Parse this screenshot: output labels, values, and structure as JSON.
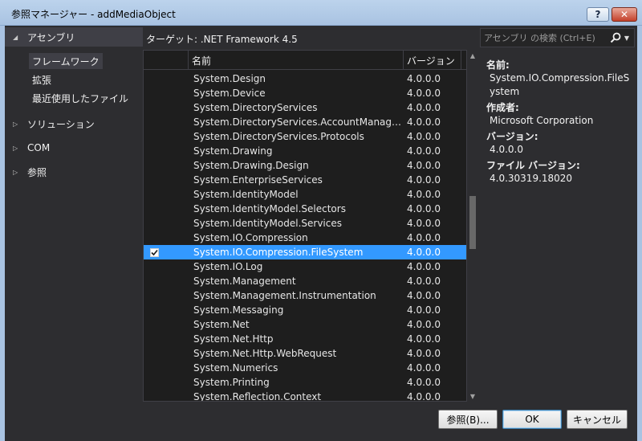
{
  "window": {
    "title": "参照マネージャー - addMediaObject",
    "help_label": "?",
    "close_label": "✕"
  },
  "nav": {
    "assemblies": {
      "label": "アセンブリ",
      "expanded": true
    },
    "assemblies_items": [
      "フレームワーク",
      "拡張",
      "最近使用したファイル"
    ],
    "solution": {
      "label": "ソリューション"
    },
    "com": {
      "label": "COM"
    },
    "browse": {
      "label": "参照"
    }
  },
  "header": {
    "target_label": "ターゲット: .NET Framework 4.5",
    "search_placeholder": "アセンブリ の検索 (Ctrl+E)"
  },
  "grid": {
    "columns": {
      "name": "名前",
      "version": "バージョン"
    },
    "rows": [
      {
        "name": "System.Design",
        "version": "4.0.0.0",
        "checked": false,
        "selected": false
      },
      {
        "name": "System.Device",
        "version": "4.0.0.0",
        "checked": false,
        "selected": false
      },
      {
        "name": "System.DirectoryServices",
        "version": "4.0.0.0",
        "checked": false,
        "selected": false
      },
      {
        "name": "System.DirectoryServices.AccountManag…",
        "version": "4.0.0.0",
        "checked": false,
        "selected": false
      },
      {
        "name": "System.DirectoryServices.Protocols",
        "version": "4.0.0.0",
        "checked": false,
        "selected": false
      },
      {
        "name": "System.Drawing",
        "version": "4.0.0.0",
        "checked": false,
        "selected": false
      },
      {
        "name": "System.Drawing.Design",
        "version": "4.0.0.0",
        "checked": false,
        "selected": false
      },
      {
        "name": "System.EnterpriseServices",
        "version": "4.0.0.0",
        "checked": false,
        "selected": false
      },
      {
        "name": "System.IdentityModel",
        "version": "4.0.0.0",
        "checked": false,
        "selected": false
      },
      {
        "name": "System.IdentityModel.Selectors",
        "version": "4.0.0.0",
        "checked": false,
        "selected": false
      },
      {
        "name": "System.IdentityModel.Services",
        "version": "4.0.0.0",
        "checked": false,
        "selected": false
      },
      {
        "name": "System.IO.Compression",
        "version": "4.0.0.0",
        "checked": false,
        "selected": false
      },
      {
        "name": "System.IO.Compression.FileSystem",
        "version": "4.0.0.0",
        "checked": true,
        "selected": true
      },
      {
        "name": "System.IO.Log",
        "version": "4.0.0.0",
        "checked": false,
        "selected": false
      },
      {
        "name": "System.Management",
        "version": "4.0.0.0",
        "checked": false,
        "selected": false
      },
      {
        "name": "System.Management.Instrumentation",
        "version": "4.0.0.0",
        "checked": false,
        "selected": false
      },
      {
        "name": "System.Messaging",
        "version": "4.0.0.0",
        "checked": false,
        "selected": false
      },
      {
        "name": "System.Net",
        "version": "4.0.0.0",
        "checked": false,
        "selected": false
      },
      {
        "name": "System.Net.Http",
        "version": "4.0.0.0",
        "checked": false,
        "selected": false
      },
      {
        "name": "System.Net.Http.WebRequest",
        "version": "4.0.0.0",
        "checked": false,
        "selected": false
      },
      {
        "name": "System.Numerics",
        "version": "4.0.0.0",
        "checked": false,
        "selected": false
      },
      {
        "name": "System.Printing",
        "version": "4.0.0.0",
        "checked": false,
        "selected": false
      },
      {
        "name": "System.Reflection.Context",
        "version": "4.0.0.0",
        "checked": false,
        "selected": false
      }
    ]
  },
  "details": {
    "name_label": "名前:",
    "name_value": "System.IO.Compression.FileSystem",
    "author_label": "作成者:",
    "author_value": "Microsoft Corporation",
    "version_label": "バージョン:",
    "version_value": "4.0.0.0",
    "file_version_label": "ファイル バージョン:",
    "file_version_value": "4.0.30319.18020"
  },
  "buttons": {
    "browse_label": "参照(B)...",
    "ok_label": "OK",
    "cancel_label": "キャンセル"
  },
  "colors": {
    "selection": "#3399ff",
    "background": "#2d2d30",
    "grid_background": "#1e1e1e"
  },
  "icons": {
    "search": "search-icon",
    "collapse": "triangle-down-icon",
    "expand": "triangle-right-icon",
    "check": "checkmark-icon"
  }
}
